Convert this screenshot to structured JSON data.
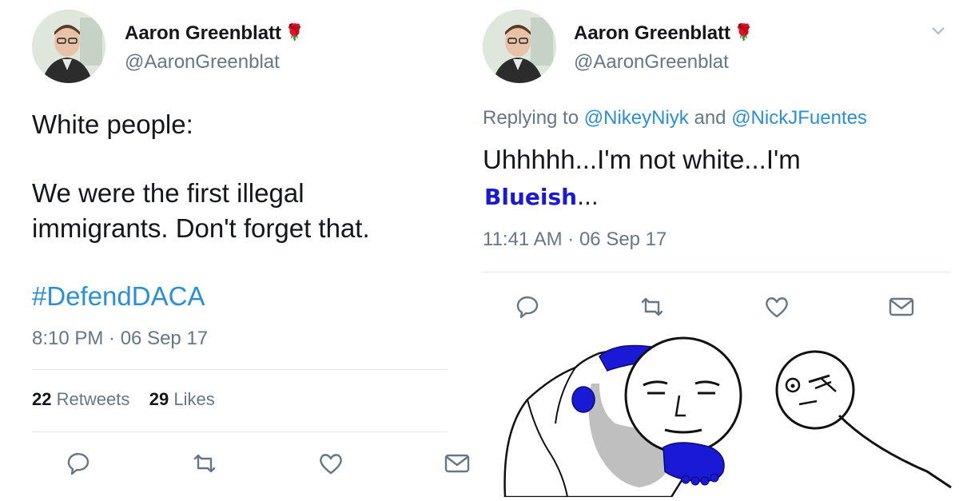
{
  "left_tweet": {
    "name": "Aaron Greenblatt",
    "handle": "@AaronGreenblat",
    "text_line1": "White people:",
    "text_line2": "We were the first illegal",
    "text_line3": "immigrants. Don't forget that.",
    "hashtag": "#DefendDACA",
    "timestamp": "8:10 PM · 06 Sep 17",
    "retweets_count": "22",
    "retweets_label": "Retweets",
    "likes_count": "29",
    "likes_label": "Likes",
    "icons": [
      "reply-icon",
      "retweet-icon",
      "like-icon",
      "message-icon"
    ]
  },
  "right_tweet": {
    "name": "Aaron Greenblatt",
    "handle": "@AaronGreenblat",
    "replying_prefix": "Replying to",
    "replying_user1": "@NikeyNiyk",
    "replying_and": "and",
    "replying_user2": "@NickJFuentes",
    "text_line1": "Uhhhhh...I'm not white...I'm",
    "text_line2": "Blueish",
    "text_line2_suffix": "...",
    "timestamp": "11:41 AM · 06 Sep 17",
    "icons": [
      "reply-icon",
      "retweet-icon",
      "like-icon",
      "message-icon",
      "chevron-down-icon"
    ]
  },
  "colors": {
    "link": "#2b8fd6",
    "muted": "#657786",
    "blue_overlay": "#1a1ad6",
    "divider": "#e1e8ed"
  }
}
